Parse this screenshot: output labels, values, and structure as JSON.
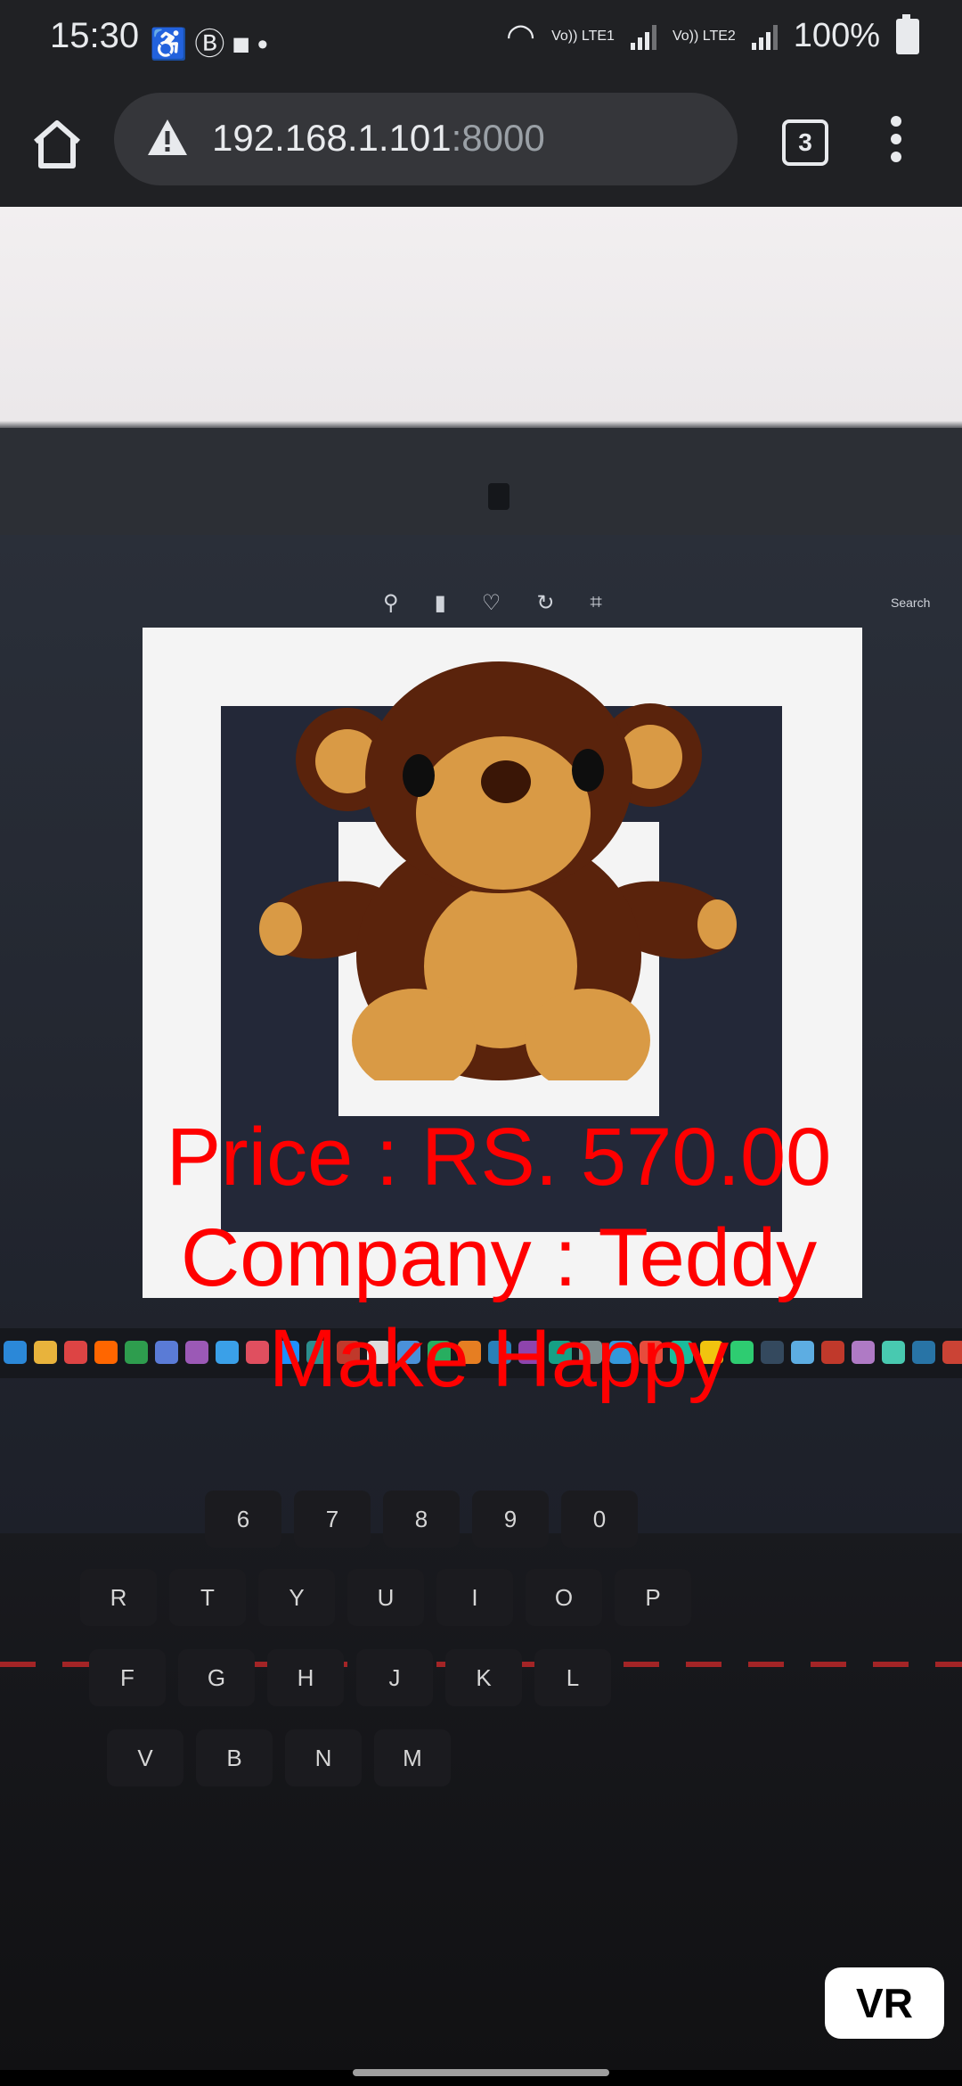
{
  "status_bar": {
    "time": "15:30",
    "left_icons": [
      "accessibility-icon",
      "b-app-icon",
      "video-call-icon",
      "dot-icon"
    ],
    "network_1": "Vo)) LTE1",
    "network_2": "Vo)) LTE2",
    "battery": "100%"
  },
  "browser": {
    "url_host": "192.168.1.101",
    "url_port": ":8000",
    "tab_count": "3",
    "security_icon": "warning-triangle-icon"
  },
  "ar_overlay": {
    "price": "Price : RS. 570.00",
    "company_line1": "Company : Teddy",
    "company_line2": "Make Happy",
    "text_color": "#ff0000",
    "model": "teddy-bear"
  },
  "vr_button": {
    "label": "VR"
  },
  "laptop_screen": {
    "search_label": "Search"
  }
}
